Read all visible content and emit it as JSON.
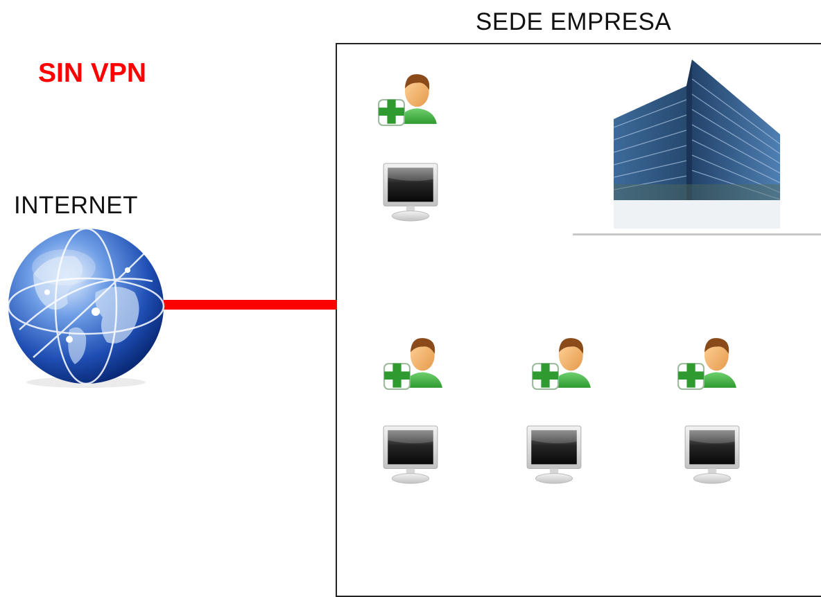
{
  "diagram": {
    "headquarters_label": "SEDE EMPRESA",
    "scenario_label": "SIN VPN",
    "internet_label": "INTERNET"
  },
  "colors": {
    "scenario": "#ff0000",
    "link": "#ff0000",
    "box_border": "#222222"
  },
  "icons": {
    "internet": "globe-icon",
    "headquarters": "office-building-icon",
    "user": "add-user-icon",
    "workstation": "computer-monitor-icon"
  }
}
